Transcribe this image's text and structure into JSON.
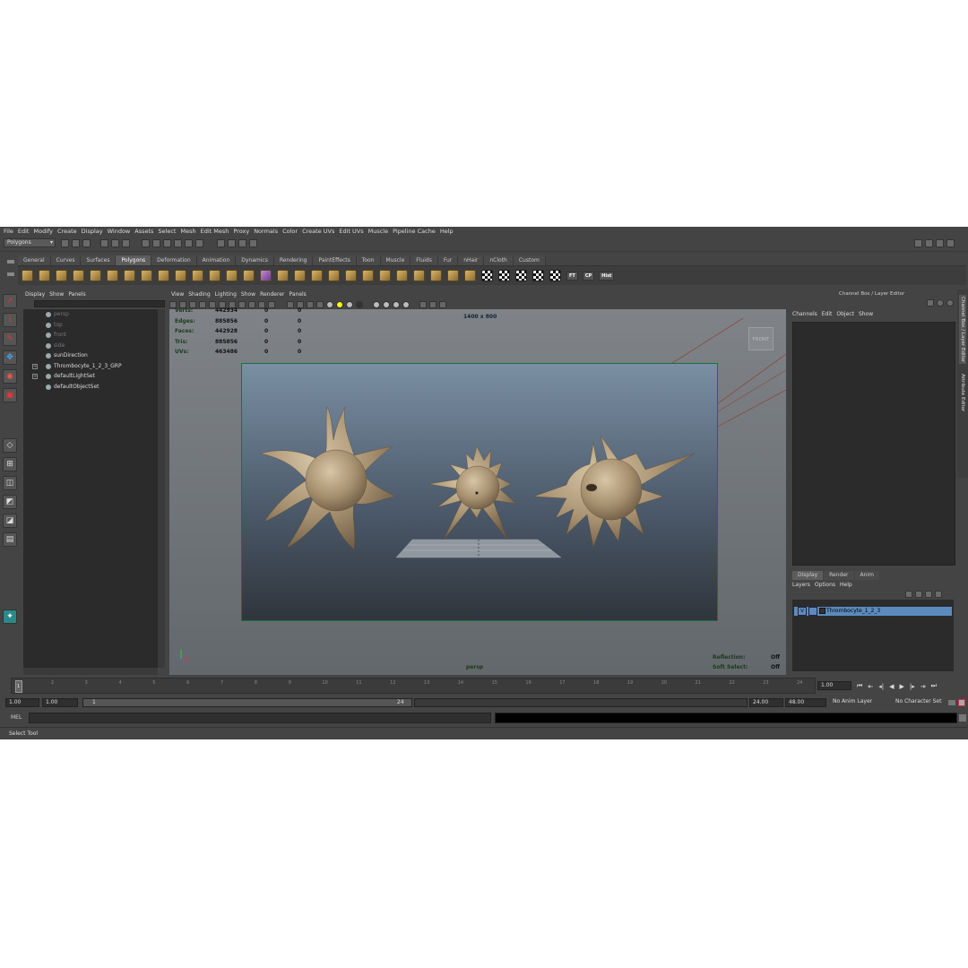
{
  "menubar": [
    "File",
    "Edit",
    "Modify",
    "Create",
    "Display",
    "Window",
    "Assets",
    "Select",
    "Mesh",
    "Edit Mesh",
    "Proxy",
    "Normals",
    "Color",
    "Create UVs",
    "Edit UVs",
    "Muscle",
    "Pipeline Cache",
    "Help"
  ],
  "mode_selector": "Polygons",
  "shelf_tabs": [
    "General",
    "Curves",
    "Surfaces",
    "Polygons",
    "Deformation",
    "Animation",
    "Dynamics",
    "Rendering",
    "PaintEffects",
    "Toon",
    "Muscle",
    "Fluids",
    "Fur",
    "nHair",
    "nCloth",
    "Custom"
  ],
  "active_shelf_tab": "Polygons",
  "shelf_buttons": {
    "ft": "FT",
    "cp": "CP",
    "hist": "Hist"
  },
  "outliner": {
    "menu": [
      "Display",
      "Show",
      "Panels"
    ],
    "items": [
      {
        "label": "persp",
        "dim": true
      },
      {
        "label": "top",
        "dim": true
      },
      {
        "label": "front",
        "dim": true
      },
      {
        "label": "side",
        "dim": true
      },
      {
        "label": "sunDirection",
        "dim": false
      },
      {
        "label": "Thrombocyte_1_2_3_GRP",
        "dim": false,
        "expandable": true
      },
      {
        "label": "defaultLightSet",
        "dim": false,
        "expandable": true
      },
      {
        "label": "defaultObjectSet",
        "dim": false
      }
    ]
  },
  "viewport": {
    "menu": [
      "View",
      "Shading",
      "Lighting",
      "Show",
      "Renderer",
      "Panels"
    ],
    "stats": [
      {
        "label": "Verts:",
        "v1": "442934",
        "v2": "0",
        "v3": "0"
      },
      {
        "label": "Edges:",
        "v1": "885856",
        "v2": "0",
        "v3": "0"
      },
      {
        "label": "Faces:",
        "v1": "442928",
        "v2": "0",
        "v3": "0"
      },
      {
        "label": "Tris:",
        "v1": "885856",
        "v2": "0",
        "v3": "0"
      },
      {
        "label": "UVs:",
        "v1": "463486",
        "v2": "0",
        "v3": "0"
      }
    ],
    "resolution": "1400 x 800",
    "viewcube": "FRONT",
    "camera": "persp",
    "reflection_label": "Reflection:",
    "reflection_value": "Off",
    "softselect_label": "Soft Select:",
    "softselect_value": "Off",
    "colors": {
      "gate": "#1e6e3a",
      "cell": "#b09a7a"
    }
  },
  "channel_box": {
    "title": "Channel Box / Layer Editor",
    "menu": [
      "Channels",
      "Edit",
      "Object",
      "Show"
    ],
    "layer_tabs": [
      "Display",
      "Render",
      "Anim"
    ],
    "layer_menu": [
      "Layers",
      "Options",
      "Help"
    ],
    "layer": {
      "visible": "V",
      "name": "Thrombocyte_1_2_3"
    }
  },
  "side_tabs": [
    "Channel Box / Layer Editor",
    "Attribute Editor"
  ],
  "timeline": {
    "ticks": [
      "1",
      "2",
      "3",
      "4",
      "5",
      "6",
      "7",
      "8",
      "9",
      "10",
      "11",
      "12",
      "13",
      "14",
      "15",
      "16",
      "17",
      "18",
      "19",
      "20",
      "21",
      "22",
      "23",
      "24"
    ],
    "current_frame": "1.00"
  },
  "range": {
    "start": "1.00",
    "anim_start": "1.00",
    "slider_start": "1",
    "slider_end": "24",
    "end": "24.00",
    "anim_end": "48.00",
    "anim_layer": "No Anim Layer",
    "character_set": "No Character Set"
  },
  "command": {
    "label": "MEL"
  },
  "help": "Select Tool"
}
